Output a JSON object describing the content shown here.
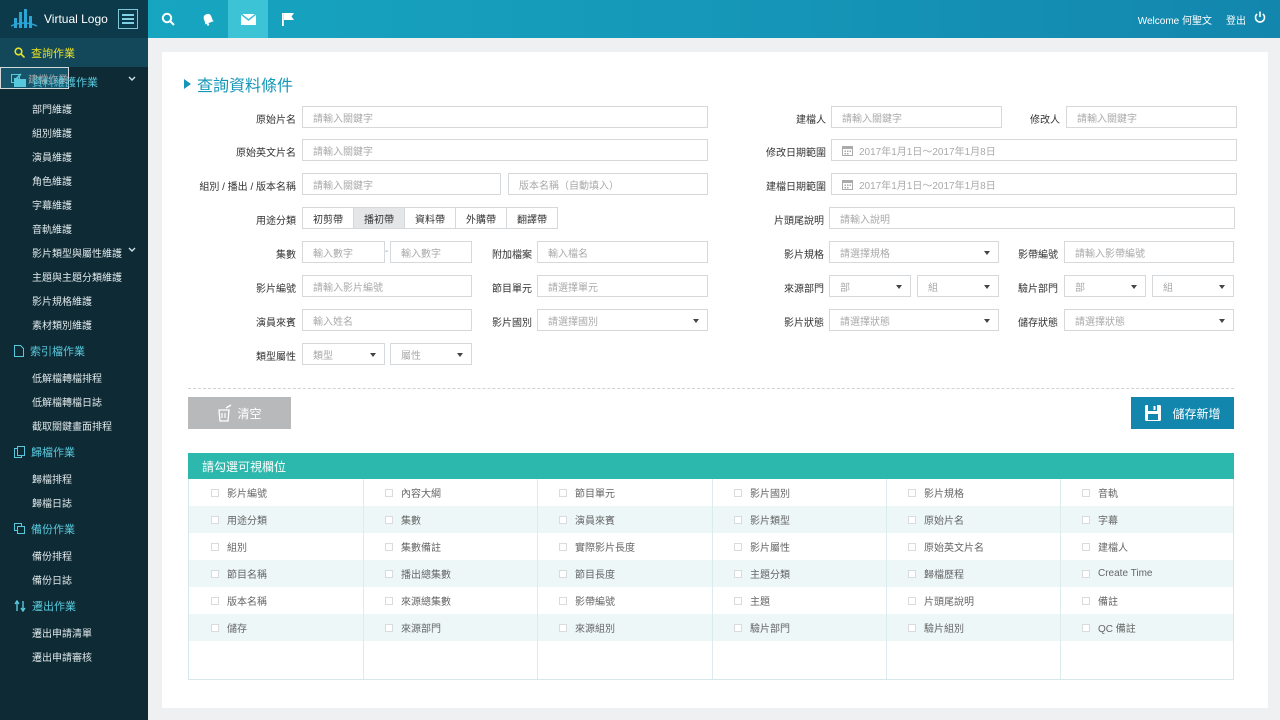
{
  "app": {
    "logo_text": "Virtual Logo"
  },
  "topbar": {
    "welcome": "Welcome 何聖文",
    "logout": "登出",
    "icons": [
      "search-icon",
      "bell-icon",
      "mail-icon",
      "flag-icon",
      "power-icon"
    ]
  },
  "sidebar": {
    "top": "查詢作業",
    "build": "建檔作業",
    "maint": "資料維護作業",
    "maint_items": [
      "部門維護",
      "組別維護",
      "演員維護",
      "角色維護",
      "字幕維護",
      "音軌維護",
      "影片類型與屬性維護",
      "主題與主題分類維護",
      "影片規格維護",
      "素材類別維護"
    ],
    "index": "索引檔作業",
    "index_items": [
      "低解檔轉檔排程",
      "低解檔轉檔日誌",
      "截取關鍵畫面排程"
    ],
    "archive": "歸檔作業",
    "archive_items": [
      "歸檔排程",
      "歸檔日誌"
    ],
    "backup": "備份作業",
    "backup_items": [
      "備份排程",
      "備份日誌"
    ],
    "transfer": "遷出作業",
    "transfer_items": [
      "遷出申請清單",
      "遷出申請審核"
    ]
  },
  "form": {
    "title": "查詢資料條件",
    "l_orig_title": "原始片名",
    "p_orig_title": "請輸入關鍵字",
    "l_orig_en": "原始英文片名",
    "p_orig_en": "請輸入關鍵字",
    "l_group": "組別 / 播出 / 版本名稱",
    "p_group": "請輸入關鍵字",
    "p_version": "版本名稱（自動填入）",
    "l_usage": "用途分類",
    "usage_opts": [
      "初剪帶",
      "播初帶",
      "資料帶",
      "外購帶",
      "翻譯帶"
    ],
    "usage_selected": "播初帶",
    "l_episodes": "集數",
    "p_ep_from": "輸入數字",
    "ep_dash": "-",
    "p_ep_to": "輸入數字",
    "l_attach": "附加檔案",
    "p_attach": "輸入檔名",
    "l_film_no": "影片編號",
    "p_film_no": "請輸入影片編號",
    "l_program": "節目單元",
    "p_program": "請選擇單元",
    "l_actor": "演員來賓",
    "p_actor": "輸入姓名",
    "l_country": "影片國別",
    "p_country": "請選擇國別",
    "l_genre": "類型屬性",
    "p_genre": "類型",
    "p_attr": "屬性",
    "l_creator": "建檔人",
    "p_creator": "請輸入關鍵字",
    "l_modifier": "修改人",
    "p_modifier": "請輸入關鍵字",
    "l_mod_range": "修改日期範圍",
    "mod_range": "2017年1月1日～2017年1月8日",
    "l_create_range": "建檔日期範圍",
    "create_range": "2017年1月1日～2017年1月8日",
    "l_tail": "片頭尾說明",
    "p_tail": "請輸入說明",
    "l_spec": "影片規格",
    "p_spec": "請選擇規格",
    "l_tape": "影帶編號",
    "p_tape": "請輸入影帶編號",
    "l_source": "來源部門",
    "p_source_dept": "部",
    "p_source_group": "組",
    "l_check": "驗片部門",
    "p_check_dept": "部",
    "p_check_group": "組",
    "l_status": "影片狀態",
    "p_status": "請選擇狀態",
    "l_storage": "儲存狀態",
    "p_storage": "請選擇狀態"
  },
  "actions": {
    "clear": "清空",
    "save": "儲存新增"
  },
  "columns": {
    "title": "請勾選可視欄位",
    "rows": [
      [
        "影片編號",
        "內容大綱",
        "節目單元",
        "影片國別",
        "影片規格",
        "音軌"
      ],
      [
        "用途分類",
        "集數",
        "演員來賓",
        "影片類型",
        "原始片名",
        "字幕"
      ],
      [
        "組別",
        "集數備註",
        "實際影片長度",
        "影片屬性",
        "原始英文片名",
        "建檔人"
      ],
      [
        "節目名稱",
        "播出總集數",
        "節目長度",
        "主題分類",
        "歸檔歷程",
        "Create Time"
      ],
      [
        "版本名稱",
        "來源總集數",
        "影帶編號",
        "主題",
        "片頭尾說明",
        "備註"
      ],
      [
        "儲存",
        "來源部門",
        "來源組別",
        "驗片部門",
        "驗片組別",
        "QC 備註"
      ]
    ]
  }
}
